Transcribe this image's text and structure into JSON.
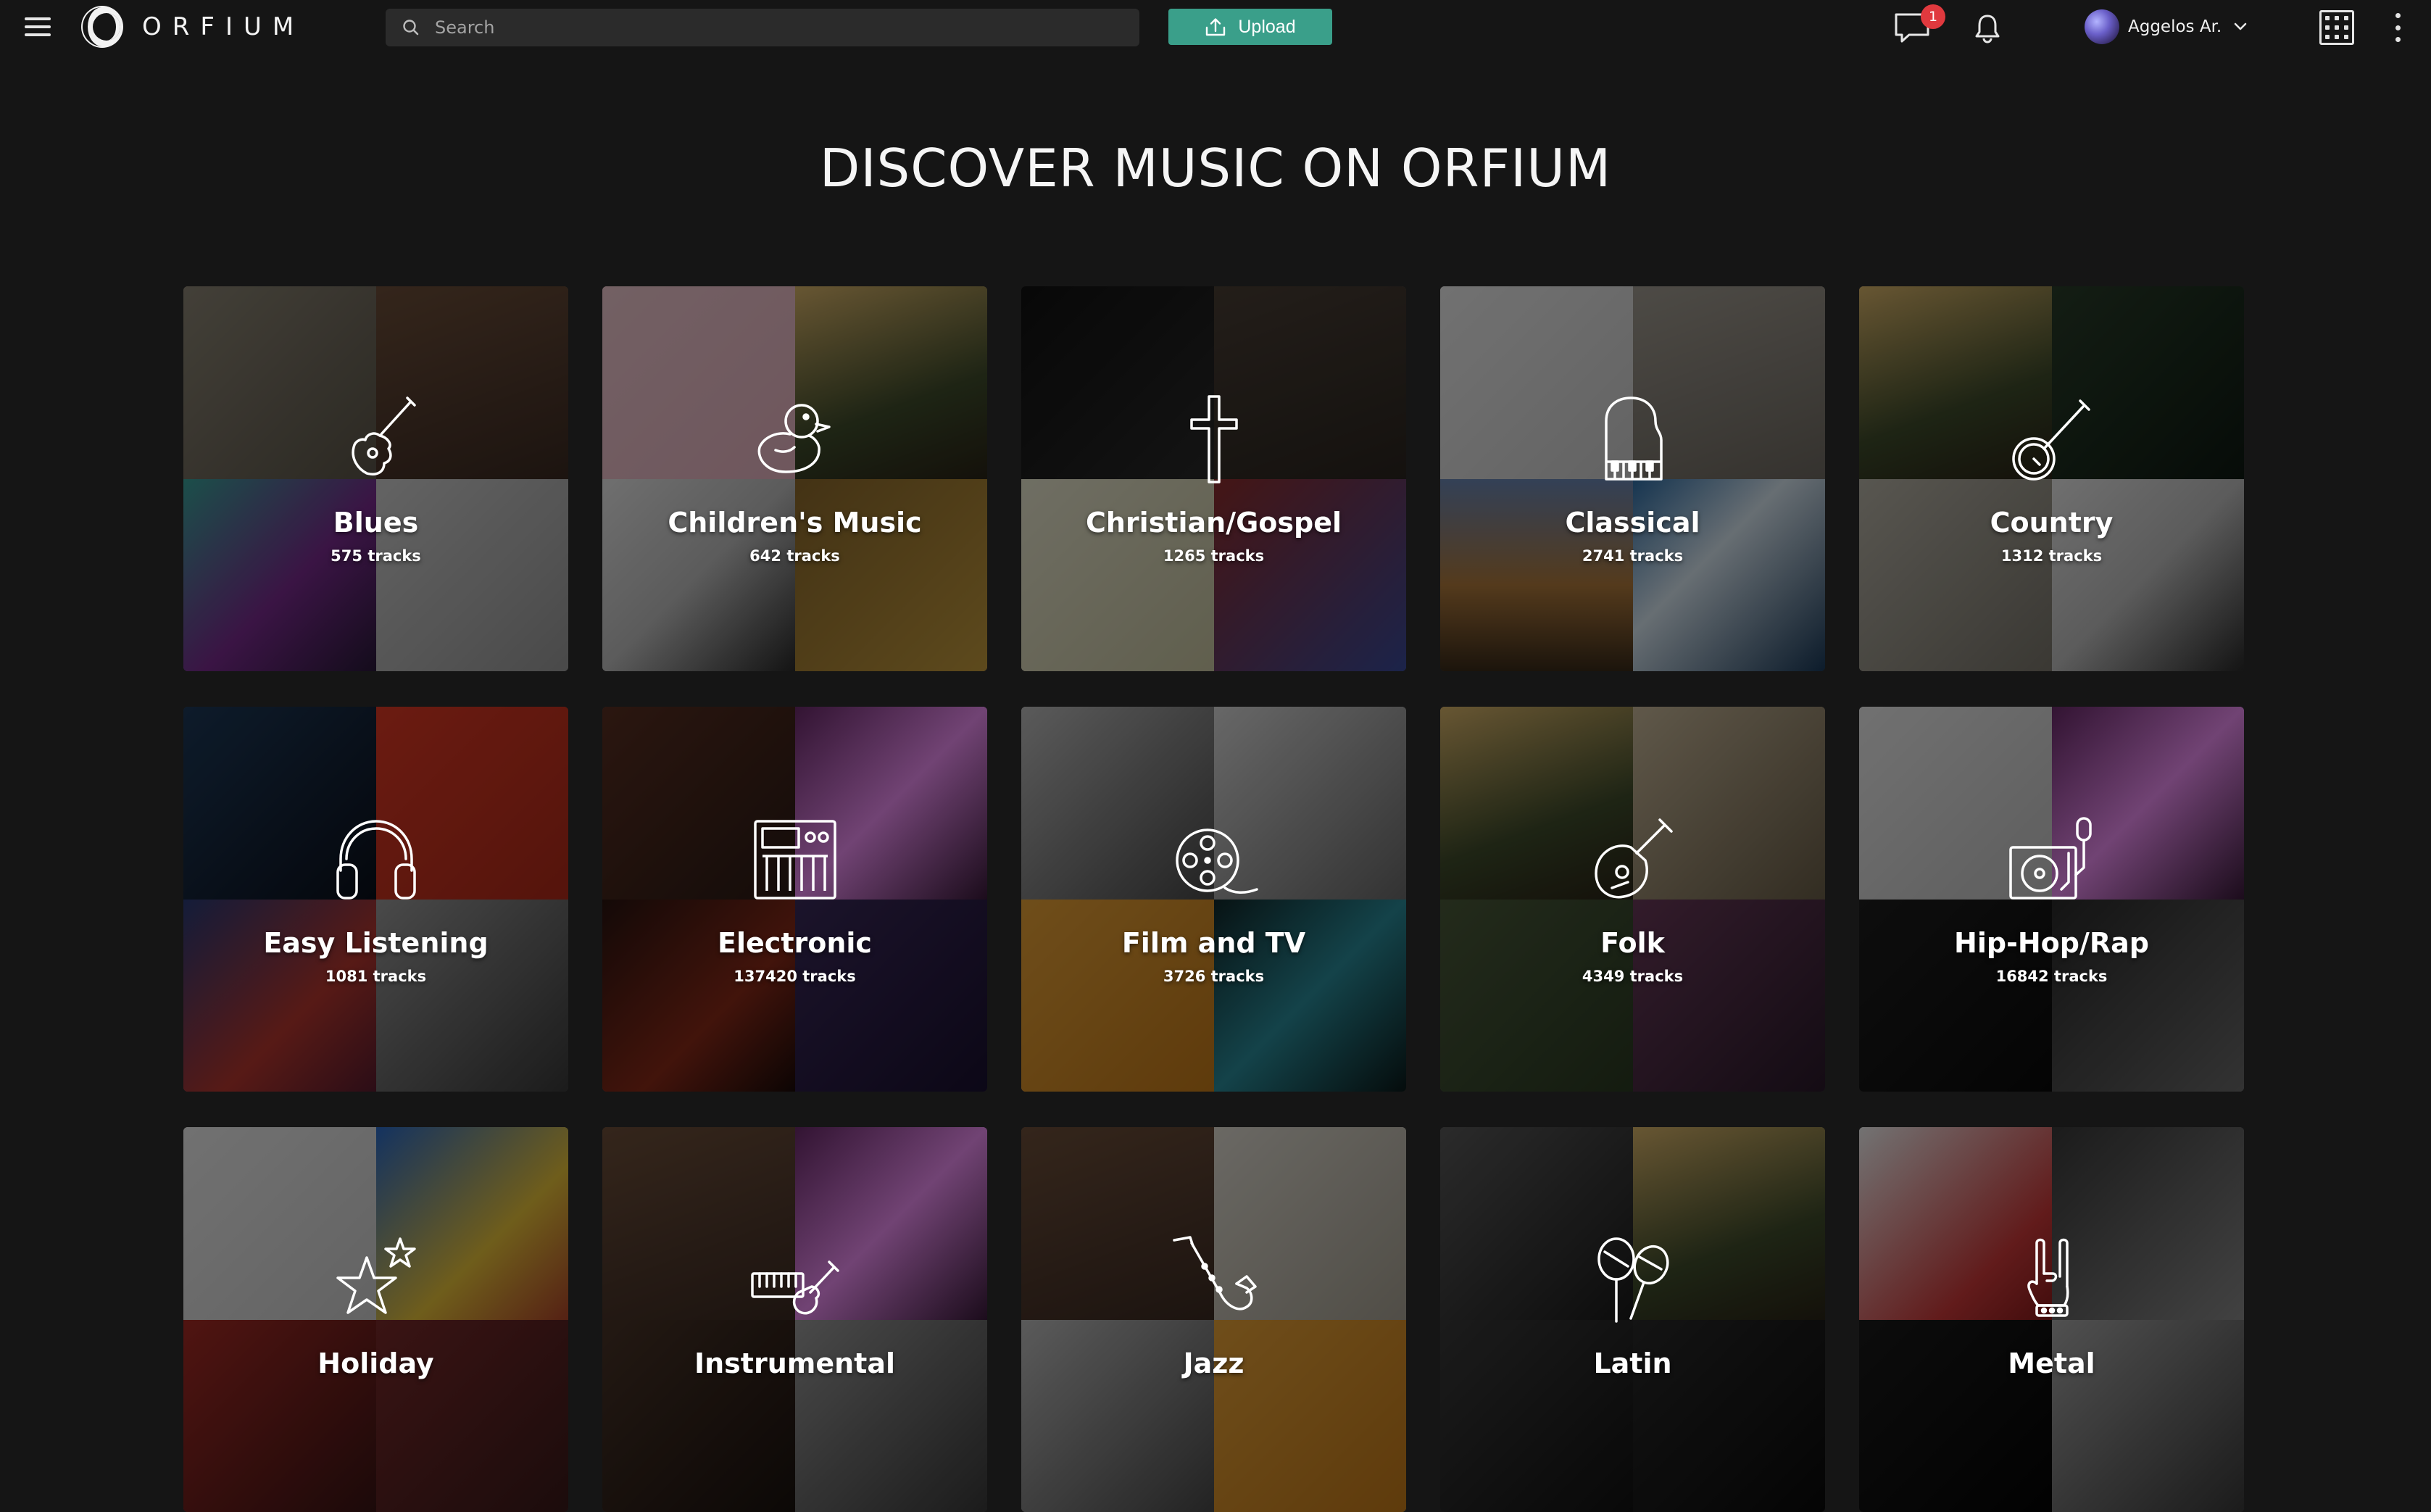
{
  "header": {
    "logo_text": "ORFIUM",
    "search_placeholder": "Search",
    "upload_label": "Upload",
    "messages_badge": "1",
    "user_name": "Aggelos Ar."
  },
  "page_title": "DISCOVER MUSIC ON ORFIUM",
  "genres": [
    {
      "name": "Blues",
      "tracks": "575 tracks",
      "icon": "guitar-icon"
    },
    {
      "name": "Children's Music",
      "tracks": "642 tracks",
      "icon": "rubber-duck-icon"
    },
    {
      "name": "Christian/Gospel",
      "tracks": "1265 tracks",
      "icon": "cross-icon"
    },
    {
      "name": "Classical",
      "tracks": "2741 tracks",
      "icon": "piano-icon"
    },
    {
      "name": "Country",
      "tracks": "1312 tracks",
      "icon": "banjo-icon"
    },
    {
      "name": "Easy Listening",
      "tracks": "1081 tracks",
      "icon": "headphones-icon"
    },
    {
      "name": "Electronic",
      "tracks": "137420 tracks",
      "icon": "synthesizer-icon"
    },
    {
      "name": "Film and TV",
      "tracks": "3726 tracks",
      "icon": "film-reel-icon"
    },
    {
      "name": "Folk",
      "tracks": "4349 tracks",
      "icon": "lute-icon"
    },
    {
      "name": "Hip-Hop/Rap",
      "tracks": "16842 tracks",
      "icon": "turntable-microphone-icon"
    },
    {
      "name": "Holiday",
      "tracks": "",
      "icon": "stars-icon"
    },
    {
      "name": "Instrumental",
      "tracks": "",
      "icon": "keyboard-violin-icon"
    },
    {
      "name": "Jazz",
      "tracks": "",
      "icon": "saxophone-icon"
    },
    {
      "name": "Latin",
      "tracks": "",
      "icon": "maracas-icon"
    },
    {
      "name": "Metal",
      "tracks": "",
      "icon": "rock-hand-icon"
    }
  ],
  "colors": {
    "background": "#151515",
    "search_bg": "#2b2b2b",
    "upload_button": "#3a9f8a",
    "badge": "#e0393e"
  }
}
